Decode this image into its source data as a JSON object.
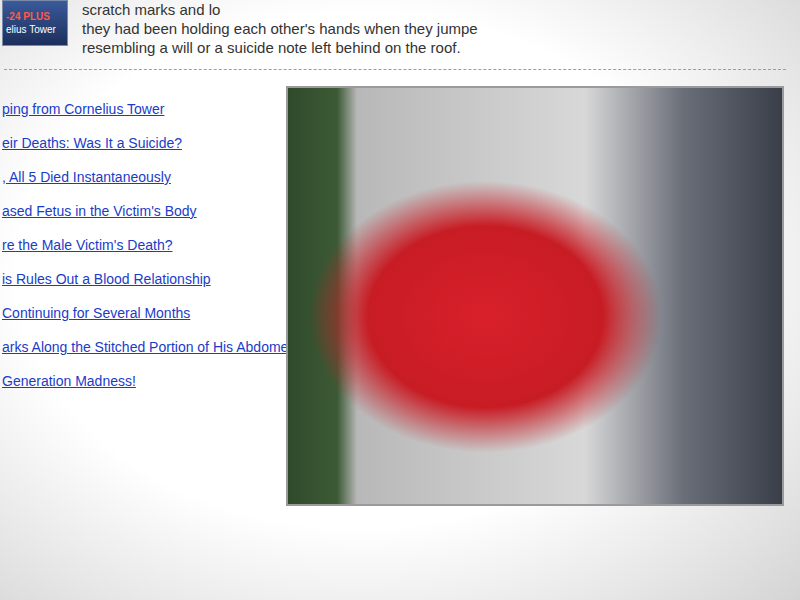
{
  "logo": {
    "lines": [
      "-24 PLUS",
      "elius Tower"
    ]
  },
  "article": {
    "lines": [
      "scratch marks and lo",
      "they had been holding each other's hands when they jumpe",
      "resembling a will or a suicide note left behind on the roof."
    ]
  },
  "links": [
    "ping from Cornelius Tower",
    "eir Deaths: Was It a Suicide?",
    ", All 5 Died Instantaneously",
    "ased Fetus in the Victim's Body",
    "re the Male Victim's Death?",
    "is Rules Out a Blood Relationship",
    "Continuing for Several Months",
    "arks Along the Stitched Portion of His Abdomen",
    "Generation Madness!"
  ]
}
